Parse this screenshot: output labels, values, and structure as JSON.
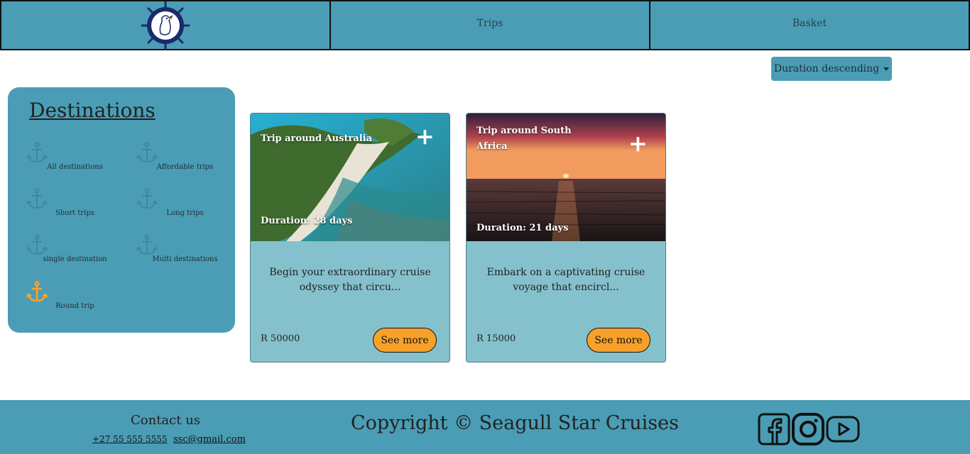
{
  "nav": {
    "logo_icon": "seagull-ship-wheel-logo",
    "trips_label": "Trips",
    "basket_label": "Basket"
  },
  "sort": {
    "selected": "Duration descending"
  },
  "destinations": {
    "title": "Destinations",
    "items": [
      {
        "label": "All destinations",
        "active": false
      },
      {
        "label": "Affordable trips",
        "active": false
      },
      {
        "label": "Short trips",
        "active": false
      },
      {
        "label": "Long trips",
        "active": false
      },
      {
        "label": "single destination",
        "active": false
      },
      {
        "label": "Multi destinations",
        "active": false
      },
      {
        "label": "Round trip",
        "active": true
      }
    ]
  },
  "cards": [
    {
      "title": "Trip around Australia",
      "duration": "Duration: 28 days",
      "description": "Begin your extraordinary cruise odyssey that circu...",
      "price": "R 50000",
      "button": "See more",
      "image": "australia-coastline-aerial"
    },
    {
      "title": "Trip around South Africa",
      "duration": "Duration: 21 days",
      "description": "Embark on a captivating cruise voyage that encircl...",
      "price": "R 15000",
      "button": "See more",
      "image": "sunset-over-ocean"
    }
  ],
  "footer": {
    "contact_title": "Contact us",
    "phone": "+27 55 555 5555",
    "email": "ssc@gmail.com",
    "copyright": "Copyright © Seagull Star Cruises",
    "social_icons": [
      "facebook-icon",
      "instagram-icon",
      "youtube-icon"
    ]
  },
  "colors": {
    "primary": "#4a9db5",
    "card_bg": "#85c1cc",
    "accent": "#f7a12a",
    "anchor_active": "#f7a12a",
    "anchor_inactive": "#3d8aa0"
  }
}
